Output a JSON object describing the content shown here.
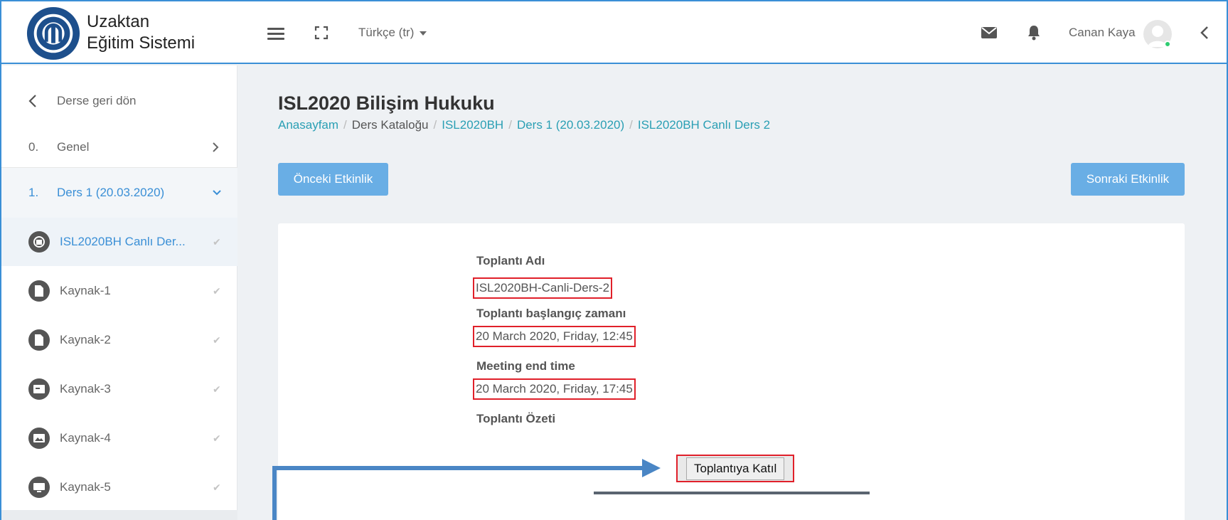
{
  "brand": {
    "line1": "Uzaktan",
    "line2": "Eğitim Sistemi"
  },
  "topbar": {
    "language": "Türkçe (tr)",
    "user_name": "Canan Kaya"
  },
  "sidebar": {
    "back_label": "Derse geri dön",
    "sections": [
      {
        "num": "0.",
        "label": "Genel"
      },
      {
        "num": "1.",
        "label": "Ders 1 (20.03.2020)"
      }
    ],
    "items": [
      {
        "label": "ISL2020BH Canlı Der...",
        "icon": "bigbluebutton-icon"
      },
      {
        "label": "Kaynak-1",
        "icon": "file-icon"
      },
      {
        "label": "Kaynak-2",
        "icon": "file-icon"
      },
      {
        "label": "Kaynak-3",
        "icon": "presentation-icon"
      },
      {
        "label": "Kaynak-4",
        "icon": "image-icon"
      },
      {
        "label": "Kaynak-5",
        "icon": "screen-icon"
      }
    ]
  },
  "main": {
    "title": "ISL2020 Bilişim Hukuku",
    "breadcrumb": [
      "Anasayfam",
      "Ders Kataloğu",
      "ISL2020BH",
      "Ders 1 (20.03.2020)",
      "ISL2020BH Canlı Ders 2"
    ],
    "prev_button": "Önceki Etkinlik",
    "next_button": "Sonraki Etkinlik",
    "meeting": {
      "name_label": "Toplantı Adı",
      "name_value": "ISL2020BH-Canli-Ders-2",
      "start_label": "Toplantı başlangıç zamanı",
      "start_value": "20 March 2020, Friday, 12:45",
      "end_label": "Meeting end time",
      "end_value": "20 March 2020, Friday, 17:45",
      "summary_label": "Toplantı Özeti",
      "join_button": "Toplantıya Katıl"
    }
  },
  "colors": {
    "accent": "#3a8fd6",
    "button": "#69aee5",
    "link": "#2a9fb4",
    "highlight": "#e0202a",
    "arrow": "#4a86c5"
  }
}
